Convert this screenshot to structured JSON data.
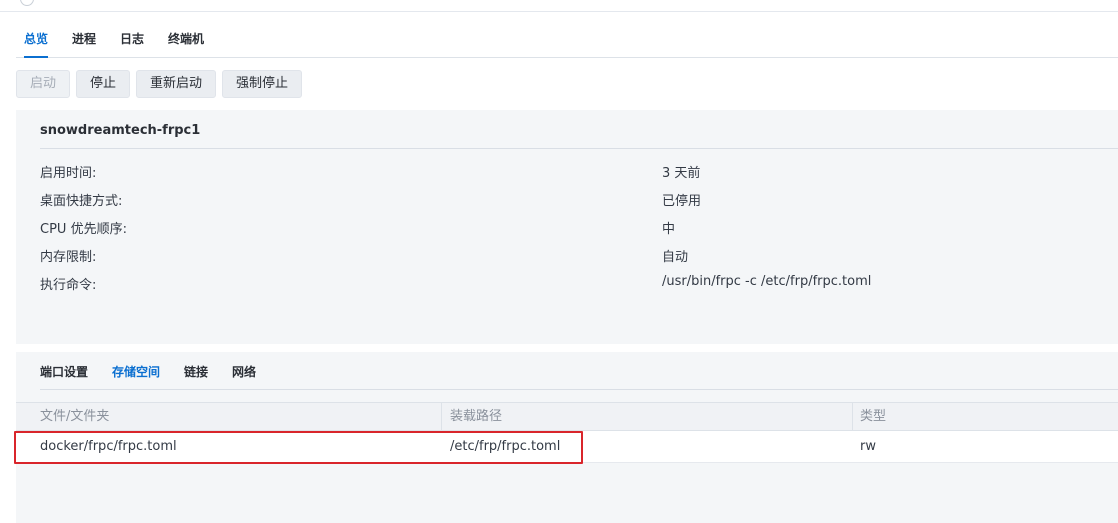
{
  "main_tabs": [
    {
      "label": "总览",
      "active": true
    },
    {
      "label": "进程",
      "active": false
    },
    {
      "label": "日志",
      "active": false
    },
    {
      "label": "终端机",
      "active": false
    }
  ],
  "toolbar": {
    "start_label": "启动",
    "stop_label": "停止",
    "restart_label": "重新启动",
    "force_stop_label": "强制停止"
  },
  "container": {
    "name": "snowdreamtech-frpc1",
    "fields": [
      {
        "label": "启用时间:",
        "value": "3 天前"
      },
      {
        "label": "桌面快捷方式:",
        "value": "已停用"
      },
      {
        "label": "CPU 优先顺序:",
        "value": "中"
      },
      {
        "label": "内存限制:",
        "value": "自动"
      },
      {
        "label": "执行命令:",
        "value": "/usr/bin/frpc -c /etc/frp/frpc.toml"
      }
    ]
  },
  "sub_tabs": [
    {
      "label": "端口设置",
      "active": false
    },
    {
      "label": "存储空间",
      "active": true
    },
    {
      "label": "链接",
      "active": false
    },
    {
      "label": "网络",
      "active": false
    }
  ],
  "volume_table": {
    "headers": [
      "文件/文件夹",
      "装载路径",
      "类型"
    ],
    "rows": [
      [
        "docker/frpc/frpc.toml",
        "/etc/frp/frpc.toml",
        "rw"
      ]
    ]
  },
  "colors": {
    "accent": "#0b6fd0",
    "highlight_border": "#d9252b",
    "panel_bg": "#f4f6f8"
  }
}
